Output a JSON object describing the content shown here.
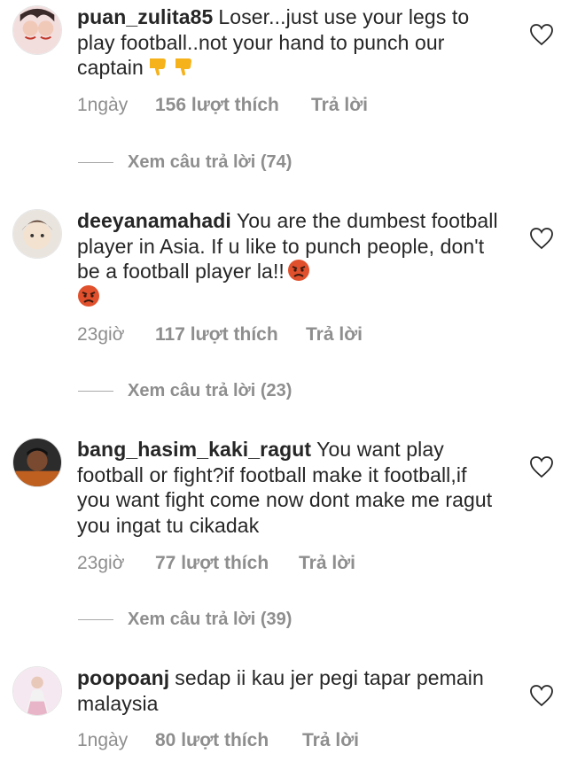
{
  "comments": [
    {
      "username": "puan_zulita85",
      "text": "Loser...just use your legs to play football..not your hand to punch our captain",
      "emoji": [
        "thumbs-down",
        "thumbs-down"
      ],
      "time": "1ngày",
      "likes": "156 lượt thích",
      "reply": "Trả lời",
      "view_replies": "Xem câu trả lời (74)"
    },
    {
      "username": "deeyanamahadi",
      "text": "You are the dumbest football player in Asia. If u like to punch people, don't be a football player la!!",
      "emoji": [
        "angry-face",
        "angry-face"
      ],
      "time": "23giờ",
      "likes": "117 lượt thích",
      "reply": "Trả lời",
      "view_replies": "Xem câu trả lời (23)"
    },
    {
      "username": "bang_hasim_kaki_ragut",
      "text": "You want play football or fight?if football make it football,if you want fight come now dont make me ragut you ingat tu cikadak",
      "emoji": [],
      "time": "23giờ",
      "likes": "77 lượt thích",
      "reply": "Trả lời",
      "view_replies": "Xem câu trả lời (39)"
    },
    {
      "username": "poopoanj",
      "text": "sedap ii kau jer pegi tapar pemain malaysia",
      "emoji": [],
      "time": "1ngày",
      "likes": "80 lượt thích",
      "reply": "Trả lời"
    }
  ],
  "colors": {
    "text": "#262626",
    "meta": "#8e8e8e",
    "emoji_yellow": "#f5b21b",
    "emoji_red": "#e0502d"
  }
}
